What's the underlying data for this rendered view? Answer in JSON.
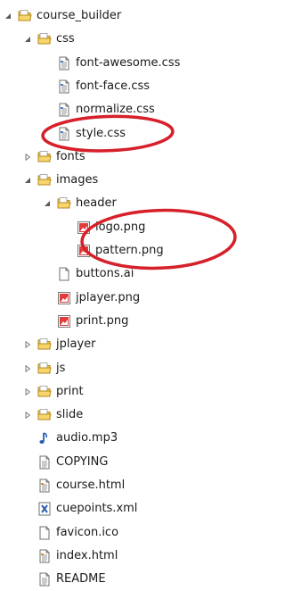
{
  "tree": {
    "items": [
      {
        "label": "course_builder",
        "type": "folder",
        "depth": 0,
        "expanded": true
      },
      {
        "label": "css",
        "type": "folder",
        "depth": 1,
        "expanded": true
      },
      {
        "label": "font-awesome.css",
        "type": "css",
        "depth": 2
      },
      {
        "label": "font-face.css",
        "type": "css",
        "depth": 2
      },
      {
        "label": "normalize.css",
        "type": "css",
        "depth": 2
      },
      {
        "label": "style.css",
        "type": "css",
        "depth": 2,
        "circled": true
      },
      {
        "label": "fonts",
        "type": "folder",
        "depth": 1,
        "expanded": false
      },
      {
        "label": "images",
        "type": "folder",
        "depth": 1,
        "expanded": true
      },
      {
        "label": "header",
        "type": "folder",
        "depth": 2,
        "expanded": true
      },
      {
        "label": "logo.png",
        "type": "image",
        "depth": 3,
        "circled": true
      },
      {
        "label": "pattern.png",
        "type": "image",
        "depth": 3,
        "circled": true
      },
      {
        "label": "buttons.ai",
        "type": "file",
        "depth": 2
      },
      {
        "label": "jplayer.png",
        "type": "image",
        "depth": 2
      },
      {
        "label": "print.png",
        "type": "image",
        "depth": 2
      },
      {
        "label": "jplayer",
        "type": "folder",
        "depth": 1,
        "expanded": false
      },
      {
        "label": "js",
        "type": "folder",
        "depth": 1,
        "expanded": false
      },
      {
        "label": "print",
        "type": "folder",
        "depth": 1,
        "expanded": false
      },
      {
        "label": "slide",
        "type": "folder",
        "depth": 1,
        "expanded": false
      },
      {
        "label": "audio.mp3",
        "type": "audio",
        "depth": 1
      },
      {
        "label": "COPYING",
        "type": "text",
        "depth": 1
      },
      {
        "label": "course.html",
        "type": "html",
        "depth": 1
      },
      {
        "label": "cuepoints.xml",
        "type": "xml",
        "depth": 1
      },
      {
        "label": "favicon.ico",
        "type": "blank",
        "depth": 1
      },
      {
        "label": "index.html",
        "type": "html",
        "depth": 1
      },
      {
        "label": "README",
        "type": "text",
        "depth": 1
      }
    ]
  },
  "colors": {
    "highlight_circle": "#d6202a",
    "folder_fill": "#f3c74f",
    "folder_stroke": "#b38a1d"
  }
}
